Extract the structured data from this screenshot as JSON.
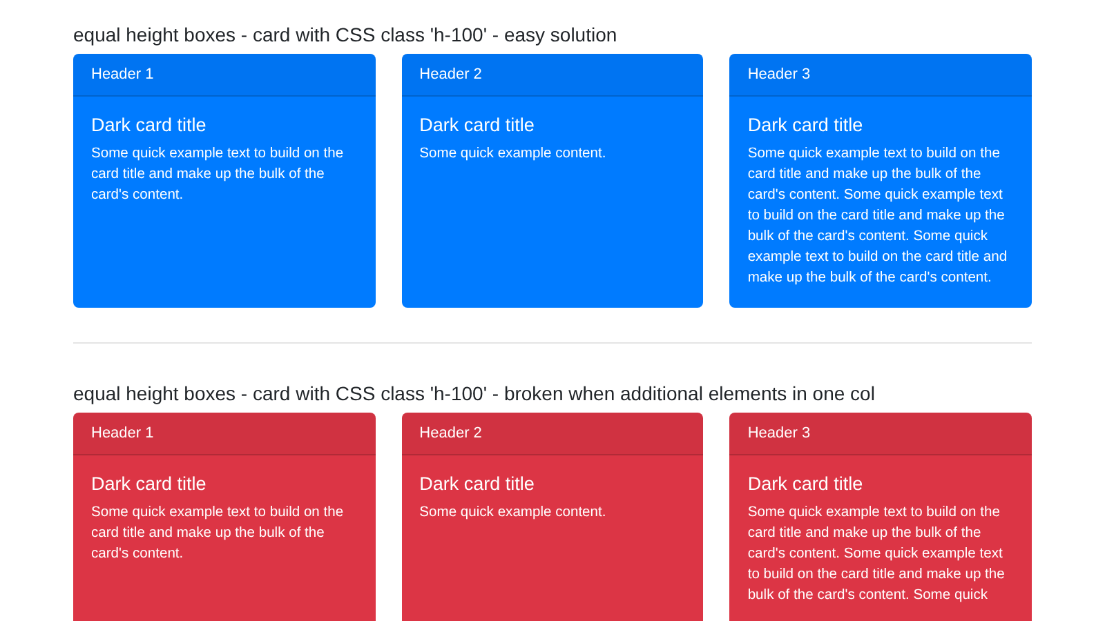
{
  "sections": [
    {
      "heading": "equal height boxes - card with CSS class 'h-100' - easy solution",
      "kind": "primary",
      "cards": [
        {
          "header": "Header 1",
          "title": "Dark card title",
          "text": "Some quick example text to build on the card title and make up the bulk of the card's content."
        },
        {
          "header": "Header 2",
          "title": "Dark card title",
          "text": "Some quick example content."
        },
        {
          "header": "Header 3",
          "title": "Dark card title",
          "text": "Some quick example text to build on the card title and make up the bulk of the card's content. Some quick example text to build on the card title and make up the bulk of the card's content. Some quick example text to build on the card title and make up the bulk of the card's content."
        }
      ]
    },
    {
      "heading": "equal height boxes - card with CSS class 'h-100' - broken when additional elements in one col",
      "kind": "danger",
      "cards": [
        {
          "header": "Header 1",
          "title": "Dark card title",
          "text": "Some quick example text to build on the card title and make up the bulk of the card's content."
        },
        {
          "header": "Header 2",
          "title": "Dark card title",
          "text": "Some quick example content."
        },
        {
          "header": "Header 3",
          "title": "Dark card title",
          "text": "Some quick example text to build on the card title and make up the bulk of the card's content. Some quick example text to build on the card title and make up the bulk of the card's content. Some quick"
        }
      ]
    }
  ]
}
